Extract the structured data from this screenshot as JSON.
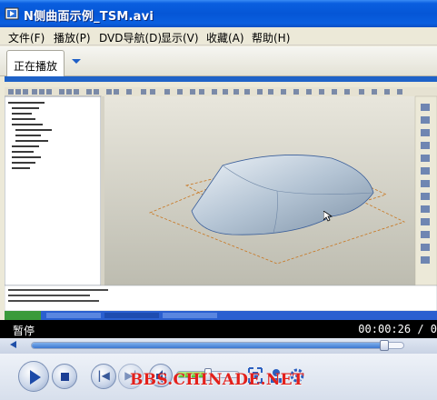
{
  "window": {
    "title": "N侧曲面示例_TSM.avi"
  },
  "menu": {
    "items": [
      "文件(F)",
      "播放(P)",
      "DVD导航(D)",
      "显示(V)",
      "收藏(A)",
      "帮助(H)"
    ]
  },
  "tabs": {
    "active_label": "正在播放"
  },
  "video": {
    "description_icon": "cad-surface-modeling-frame"
  },
  "status": {
    "state": "暂停",
    "time": "00:00:26 / 0"
  },
  "seek": {
    "progress": 0.96
  },
  "volume": {
    "level": 0.5
  },
  "watermark": {
    "text": "BBS.CHINADE.NET"
  },
  "colors": {
    "titlebar": "#0556d6",
    "watermark": "#e3201b",
    "accent": "#1f5fc7"
  }
}
